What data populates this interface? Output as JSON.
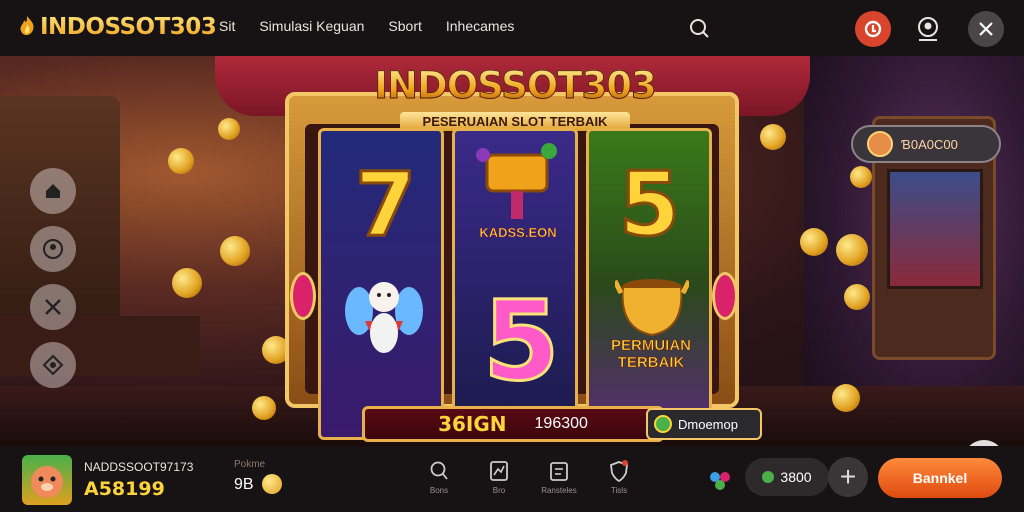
{
  "header": {
    "logo_text": "INDOSSOT303",
    "nav": [
      "Sit",
      "Simulasi Keguan",
      "Sbort",
      "Inhecames"
    ],
    "icons": [
      "search-icon",
      "gift-icon",
      "profile-icon",
      "close-icon"
    ]
  },
  "balance_pill": {
    "value": "Ɓ0A0C00"
  },
  "side_icons": [
    "home-icon",
    "user-icon",
    "tools-icon",
    "settings-icon"
  ],
  "machine": {
    "title": "INDOSSOT303",
    "subtitle": "PESERUAIAN SLOT TERBAIK",
    "reels": [
      {
        "top": "7",
        "bottom": "angel"
      },
      {
        "top_label": "KADSS.EON",
        "bottom": "5"
      },
      {
        "top": "5",
        "bottom_label": "PERMUIAN TERBAIK"
      }
    ],
    "win_label": "36IGN",
    "win_value": "196300",
    "bonus_label": "Dmoemop"
  },
  "bottom": {
    "username": "NADDSSOOT97173",
    "amount": "A58199",
    "level_label": "Pokme",
    "level": "9B",
    "nav": [
      {
        "icon": "search-icon",
        "label": "Bons"
      },
      {
        "icon": "stats-icon",
        "label": "Bro"
      },
      {
        "icon": "history-icon",
        "label": "Ransteles"
      },
      {
        "icon": "shield-icon",
        "label": "Tisls"
      }
    ],
    "coins": "3800",
    "cta": "Bannkel"
  },
  "colors": {
    "accent": "#e04a10",
    "gold": "#ffd33a",
    "bar": "#171314"
  }
}
